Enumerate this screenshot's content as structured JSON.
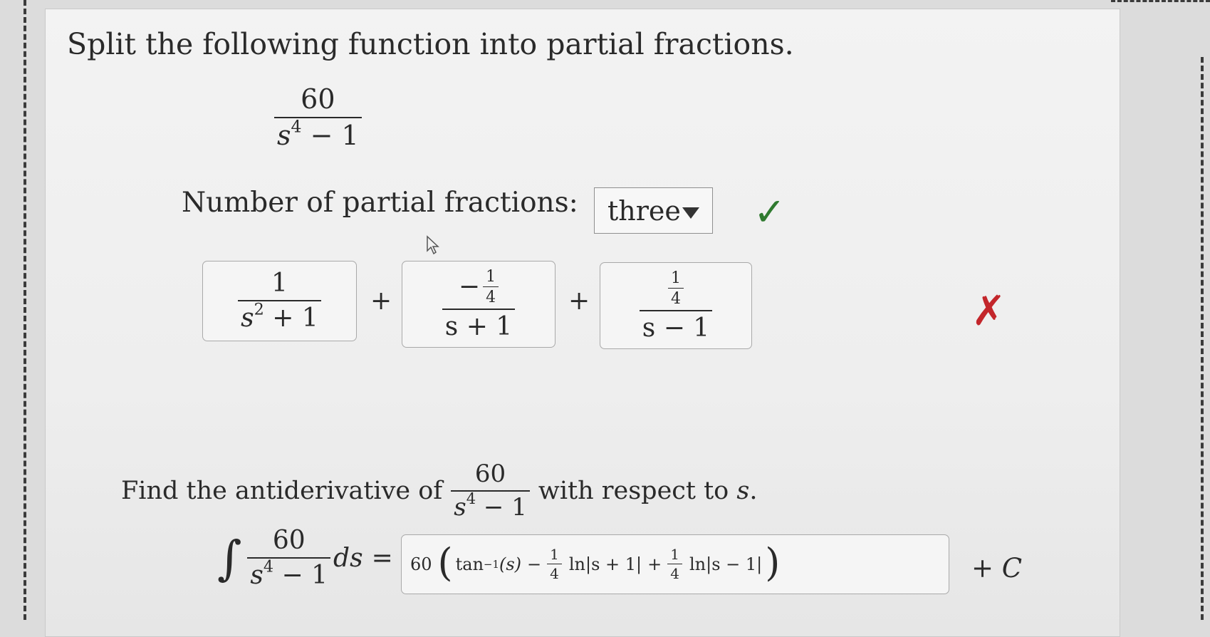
{
  "instruction": "Split the following function into partial fractions.",
  "function": {
    "numerator": "60",
    "denominator_base": "s",
    "denominator_exp": "4",
    "denominator_rest": " − 1"
  },
  "num_partial": {
    "label": "Number of partial fractions:",
    "selected": "three",
    "status": "correct"
  },
  "partial_fractions": [
    {
      "numerator": "1",
      "denominator_base": "s",
      "denominator_exp": "2",
      "denominator_rest": " + 1"
    },
    {
      "numerator_sign": "−",
      "numerator_num": "1",
      "numerator_den": "4",
      "denominator": "s + 1"
    },
    {
      "numerator_num": "1",
      "numerator_den": "4",
      "denominator": "s − 1"
    }
  ],
  "plus_sign": "+",
  "partial_status": "incorrect",
  "antiderivative": {
    "prefix": "Find the antiderivative of",
    "suffix": "with respect to",
    "variable": "s",
    "period": ".",
    "integral_sign": "∫",
    "ds": "ds",
    "equals": "=",
    "answer": {
      "coef": "60",
      "tan": "tan",
      "tan_exp": "−1",
      "tan_arg": "(s)",
      "minus": "−",
      "frac_num": "1",
      "frac_den": "4",
      "ln1": "ln|s + 1|",
      "plus": "+",
      "ln2": "ln|s − 1|"
    },
    "plus_c": "+ C"
  },
  "icons": {
    "check": "✓",
    "cross": "✗"
  },
  "colors": {
    "correct": "#2f7a2f",
    "incorrect": "#c3262b"
  }
}
